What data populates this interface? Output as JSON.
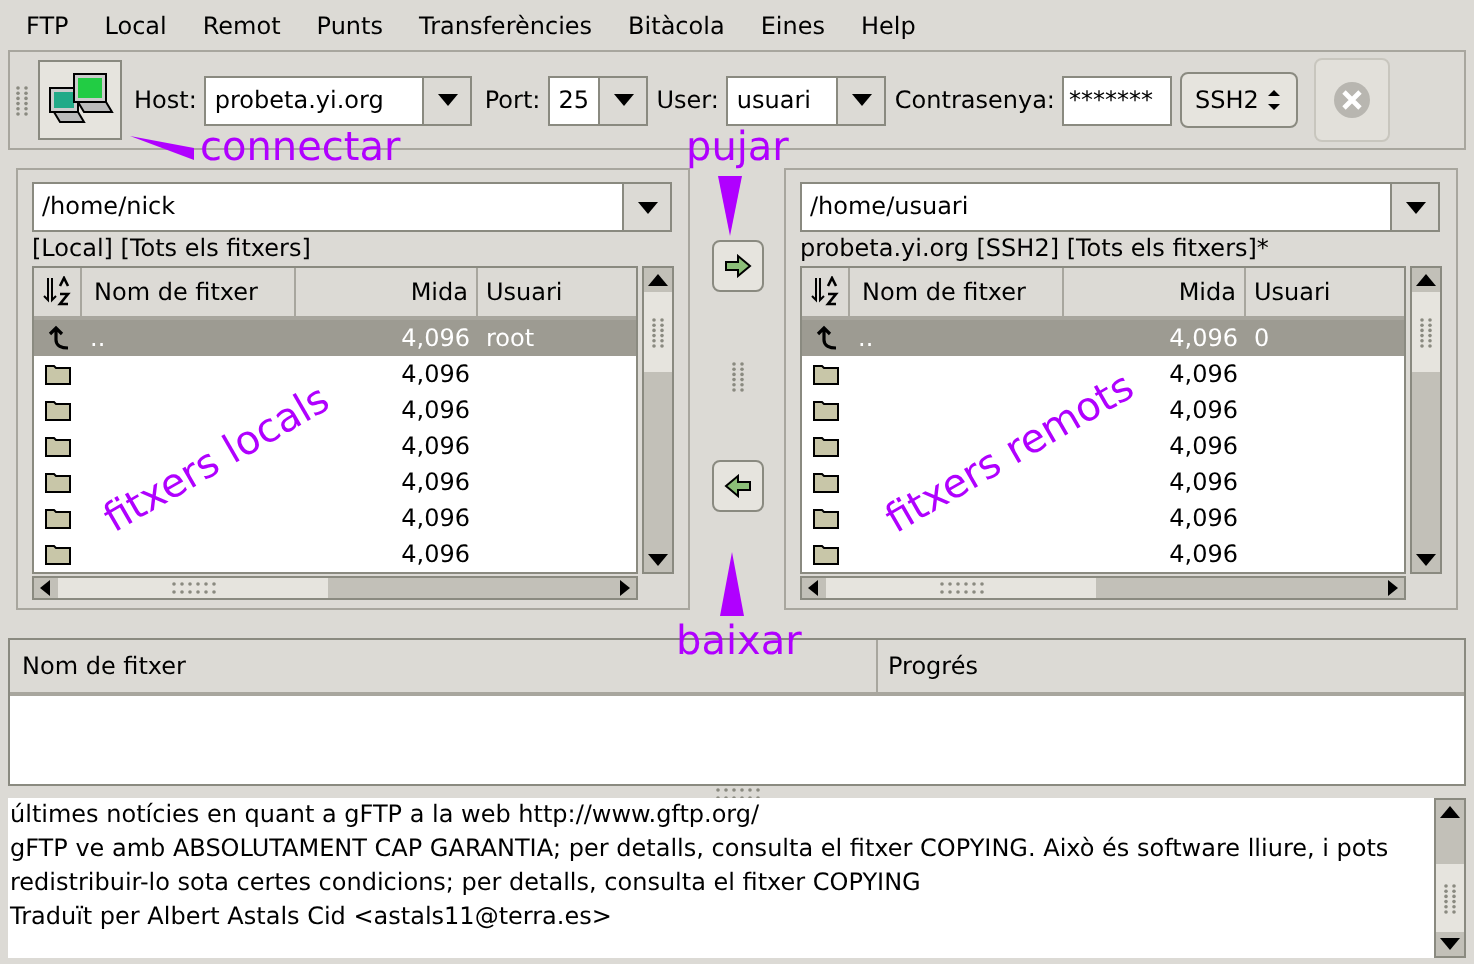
{
  "menu": [
    {
      "label": "FTP"
    },
    {
      "label": "Local"
    },
    {
      "label": "Remot"
    },
    {
      "label": "Punts"
    },
    {
      "label": "Transferències"
    },
    {
      "label": "Bitàcola"
    },
    {
      "label": "Eines"
    },
    {
      "label": "Help"
    }
  ],
  "toolbar": {
    "host_label": {
      "label": "Host:"
    },
    "host": "probeta.yi.org",
    "port_label": {
      "label": "Port:"
    },
    "port": "25",
    "user_label": {
      "label": "User:"
    },
    "user": "usuari",
    "password_label": {
      "label": "Contrasenya:"
    },
    "password": "*******",
    "protocol": "SSH2",
    "stop_disabled": true
  },
  "panels": [
    {
      "path": "/home/nick",
      "status": "[Local] [Tots els fitxers]",
      "columns": [
        "Nom de fitxer",
        "Mida",
        "Usuari"
      ],
      "rows": [
        {
          "kind": "up",
          "name": "..",
          "size": "4,096",
          "user": "root",
          "selected": true
        },
        {
          "kind": "folder",
          "size": "4,096",
          "selected": false
        },
        {
          "kind": "folder",
          "size": "4,096",
          "selected": false
        },
        {
          "kind": "folder",
          "size": "4,096",
          "selected": false
        },
        {
          "kind": "folder",
          "size": "4,096",
          "selected": false
        },
        {
          "kind": "folder",
          "size": "4,096",
          "selected": false
        },
        {
          "kind": "folder",
          "size": "4,096",
          "selected": false
        }
      ]
    },
    {
      "path": "/home/usuari",
      "status": "probeta.yi.org [SSH2] [Tots els fitxers]*",
      "columns": [
        "Nom de fitxer",
        "Mida",
        "Usuari"
      ],
      "rows": [
        {
          "kind": "up",
          "name": "..",
          "size": "4,096",
          "user": "0",
          "selected": true
        },
        {
          "kind": "folder",
          "size": "4,096",
          "selected": false
        },
        {
          "kind": "folder",
          "size": "4,096",
          "selected": false
        },
        {
          "kind": "folder",
          "size": "4,096",
          "selected": false
        },
        {
          "kind": "folder",
          "size": "4,096",
          "selected": false
        },
        {
          "kind": "folder",
          "size": "4,096",
          "selected": false
        },
        {
          "kind": "folder",
          "size": "4,096",
          "selected": false
        }
      ]
    }
  ],
  "transfers": {
    "columns": [
      "Nom de fitxer",
      "Progrés"
    ]
  },
  "log": [
    "últimes notícies en quant a gFTP a la web http://www.gftp.org/",
    "gFTP ve amb ABSOLUTAMENT CAP GARANTIA; per detalls, consulta el fitxer COPYING. Això és software lliure, i pots redistribuir-lo sota certes condicions; per detalls, consulta el fitxer COPYING",
    "Traduït per Albert Astals Cid <astals11@terra.es>"
  ],
  "annotations": [
    "connectar",
    "pujar",
    "baixar",
    "fitxers locals",
    "fitxers remots"
  ]
}
